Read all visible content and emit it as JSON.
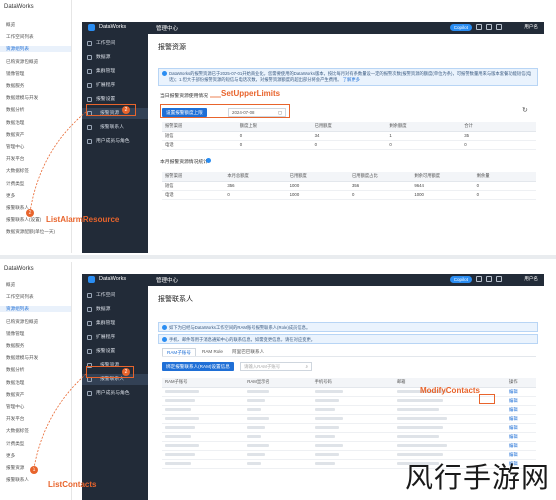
{
  "shot1": {
    "outer_sidebar": {
      "brand": "DataWorks",
      "items": [
        {
          "label": "概览"
        },
        {
          "label": "工作空间列表"
        },
        {
          "label": "资源组列表",
          "selected": true
        },
        {
          "label": "已购资源包概览"
        },
        {
          "label": "镜像管理"
        },
        {
          "label": "数据服务"
        },
        {
          "label": "数据建模与开发"
        },
        {
          "label": "数据分析"
        },
        {
          "label": "数据治理"
        },
        {
          "label": "数据资产"
        },
        {
          "label": "管理中心"
        },
        {
          "label": "开发平台"
        },
        {
          "label": "大数据标签"
        },
        {
          "label": "计费类型"
        },
        {
          "label": "更多"
        },
        {
          "label": "报警联系人"
        },
        {
          "label": "报警联系人(设置)"
        },
        {
          "label": "数据资源配额(单位一天)"
        }
      ]
    },
    "topbar": {
      "product": "DataWorks",
      "center": "管理中心",
      "copilot": "Copilot",
      "user": "用户名"
    },
    "inner_sidebar": [
      {
        "label": "工作空间"
      },
      {
        "label": "数据源"
      },
      {
        "label": "集群管理"
      },
      {
        "label": "扩展程序"
      },
      {
        "label": "报警设置"
      },
      {
        "label": "报警资源",
        "active": true
      },
      {
        "label": "报警联系人"
      },
      {
        "label": "用户成员与角色"
      }
    ],
    "page_title": "报警资源",
    "alert": "DataWorks的报警资源已于2025-07-01开始商业化，您需要使用的DataWorks版本，按比每月对有条数量设一定的报警次数(报警资源的额度(单位为条)，可报警数量用来与版本套餐功能短信(电话)；1.但大于部份报警资源的短信与电话次数，对报警资源额度的超出部分将会产生费用。",
    "alert_link": "了解更多",
    "section1_title": "当日报警资源使用情况",
    "set_limit_button": "设置报警额度上限",
    "date_value": "2024-07-08",
    "table1": {
      "headers": [
        "报警渠道",
        "额度上限",
        "已用额度",
        "剩余额度",
        "合计"
      ],
      "rows": [
        [
          "短信",
          "0",
          "34",
          "1",
          "35"
        ],
        [
          "电话",
          "0",
          "0",
          "0",
          "0"
        ]
      ]
    },
    "section2_title": "本月报警资源情况统计",
    "table2": {
      "headers": [
        "报警渠道",
        "本月总额度",
        "已用额度",
        "已用额度占比",
        "剩余可用额度",
        "剩余量"
      ],
      "rows": [
        [
          "短信",
          "356",
          "1000",
          "356",
          "9644",
          "0"
        ],
        [
          "电话",
          "0",
          "1000",
          "0",
          "1000",
          "0"
        ]
      ]
    },
    "callouts": {
      "set_upper_limits": "SetUpperLimits",
      "list_alarm_resource": "ListAlarmResource",
      "badge1": "1",
      "badge2": "2",
      "badge_left": "2"
    }
  },
  "shot2": {
    "outer_sidebar": {
      "brand": "DataWorks",
      "items": [
        {
          "label": "概览"
        },
        {
          "label": "工作空间列表"
        },
        {
          "label": "资源组列表",
          "selected": true
        },
        {
          "label": "已购资源包概览"
        },
        {
          "label": "镜像管理"
        },
        {
          "label": "数据服务"
        },
        {
          "label": "数据建模与开发"
        },
        {
          "label": "数据分析"
        },
        {
          "label": "数据治理"
        },
        {
          "label": "数据资产"
        },
        {
          "label": "管理中心"
        },
        {
          "label": "开发平台"
        },
        {
          "label": "大数据标签"
        },
        {
          "label": "计费类型"
        },
        {
          "label": "更多"
        },
        {
          "label": "报警资源"
        },
        {
          "label": "报警联系人"
        }
      ]
    },
    "topbar": {
      "product": "DataWorks",
      "center": "管理中心",
      "copilot": "Copilot",
      "user": "用户名"
    },
    "inner_sidebar": [
      {
        "label": "工作空间"
      },
      {
        "label": "数据源"
      },
      {
        "label": "集群管理"
      },
      {
        "label": "扩展程序"
      },
      {
        "label": "报警设置"
      },
      {
        "label": "报警资源"
      },
      {
        "label": "报警联系人",
        "active": true
      },
      {
        "label": "用户成员与角色"
      }
    ],
    "page_title": "报警联系人",
    "alert1": "如下为已经与DataWorks工作空间的RAM账号报警联系人(Role)成员信息。",
    "alert2": "手机、邮件等用于消息通知中心的联系信息，如需变更信息，请在对应变更。",
    "tabs": [
      "RAM子账号",
      "RAM Role",
      "阿里巴巴联系人"
    ],
    "bind_button": "绑定报警联系人(RAM)设置信息",
    "search_placeholder": "请输入RAM子账号",
    "table": {
      "headers": [
        "RAM子账号",
        "RAM显示名",
        "手机号码",
        "邮箱",
        "操作"
      ],
      "row_count": 9,
      "action_label": "编辑"
    },
    "callouts": {
      "modify_contacts": "ModifyContacts",
      "list_contacts": "ListContacts",
      "badge2": "2",
      "badge_left": "1"
    }
  },
  "watermark": "风行手游网",
  "colors": {
    "accent": "#1f6fd6",
    "callout": "#e8642c",
    "dark_bar": "#222b38"
  }
}
